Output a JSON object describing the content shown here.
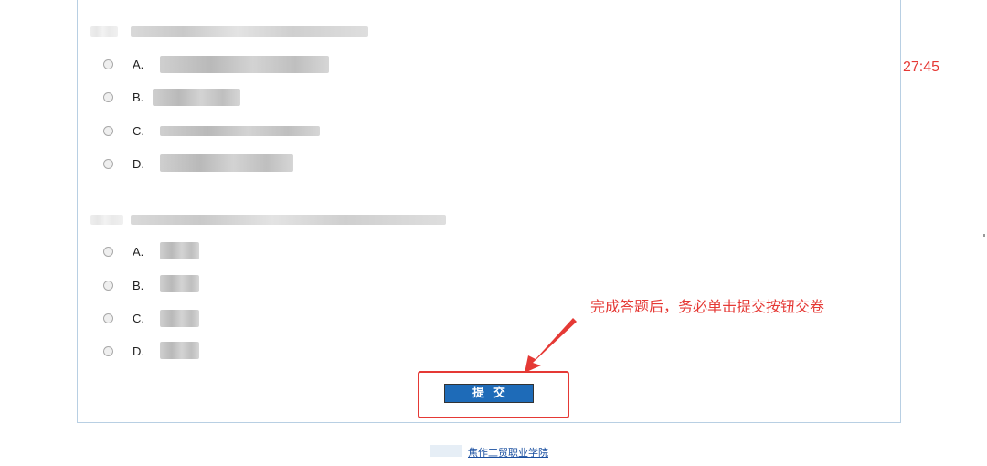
{
  "timer": {
    "text": "27:45"
  },
  "questions": [
    {
      "options": [
        {
          "letter": "A."
        },
        {
          "letter": "B."
        },
        {
          "letter": "C."
        },
        {
          "letter": "D."
        }
      ]
    },
    {
      "options": [
        {
          "letter": "A."
        },
        {
          "letter": "B."
        },
        {
          "letter": "C."
        },
        {
          "letter": "D."
        }
      ]
    }
  ],
  "submit": {
    "label": "提交"
  },
  "annotation": {
    "text": "完成答题后，务必单击提交按钮交卷",
    "color": "#e53935"
  },
  "footer": {
    "link_text": "焦作工贸职业学院"
  },
  "colors": {
    "button_bg": "#1e6bb8",
    "panel_border": "#b8cfe3",
    "annotation": "#e53935"
  }
}
